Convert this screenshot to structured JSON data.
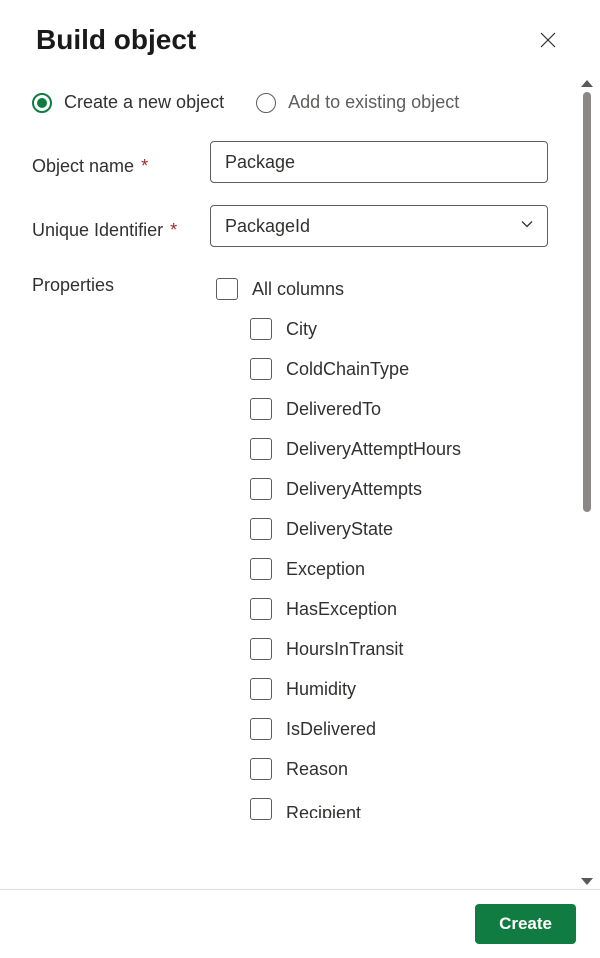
{
  "header": {
    "title": "Build object"
  },
  "mode": {
    "create_label": "Create a new object",
    "existing_label": "Add to existing object",
    "selected": "create"
  },
  "fields": {
    "object_name": {
      "label": "Object name",
      "required_mark": "*",
      "value": "Package"
    },
    "unique_identifier": {
      "label": "Unique Identifier",
      "required_mark": "*",
      "value": "PackageId"
    }
  },
  "properties": {
    "label": "Properties",
    "all_columns_label": "All columns",
    "items": [
      "City",
      "ColdChainType",
      "DeliveredTo",
      "DeliveryAttemptHours",
      "DeliveryAttempts",
      "DeliveryState",
      "Exception",
      "HasException",
      "HoursInTransit",
      "Humidity",
      "IsDelivered",
      "Reason",
      "Recipient"
    ]
  },
  "footer": {
    "create_button": "Create"
  },
  "colors": {
    "accent": "#107c41",
    "text_primary": "#323130",
    "text_secondary": "#605e5c",
    "border": "#605e5c",
    "required": "#a4262c"
  }
}
